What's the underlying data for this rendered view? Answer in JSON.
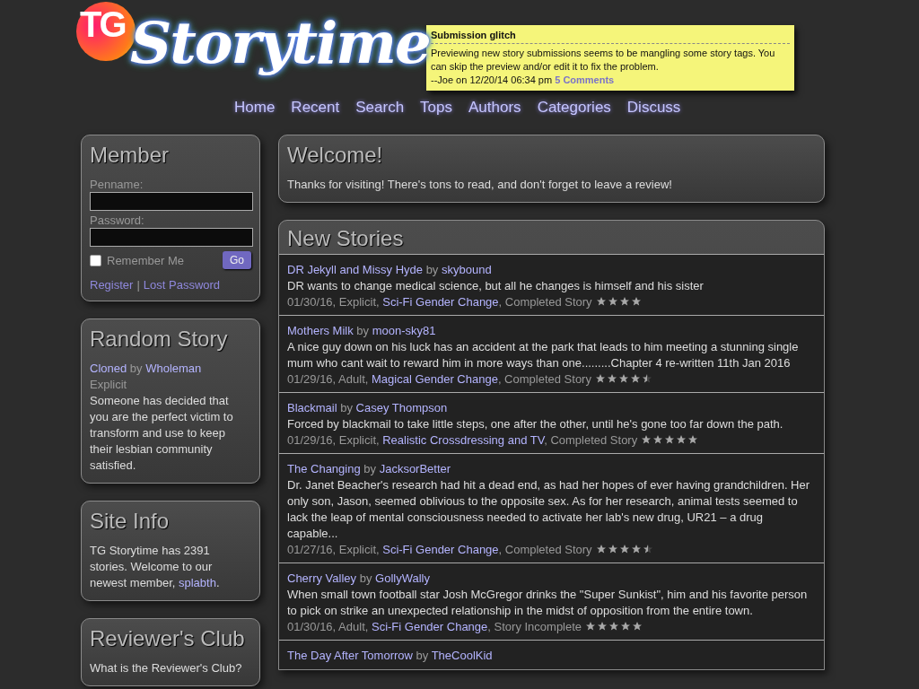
{
  "logo": {
    "badge": "TG",
    "wordmark": "Storytime"
  },
  "announcement": {
    "title": "Submission glitch",
    "body": "Previewing new story submissions seems to be mangling some story tags. You can skip the preview and/or edit it to fix the problem.",
    "byline": "--Joe on 12/20/14 06:34 pm",
    "link": "5 Comments"
  },
  "nav": [
    {
      "label": "Home"
    },
    {
      "label": "Recent"
    },
    {
      "label": "Search"
    },
    {
      "label": "Tops"
    },
    {
      "label": "Authors"
    },
    {
      "label": "Categories"
    },
    {
      "label": "Discuss"
    }
  ],
  "sidebar": {
    "member": {
      "title": "Member",
      "penname_label": "Penname:",
      "password_label": "Password:",
      "remember": {
        "label": "Remember Me",
        "checked": false
      },
      "button": "Go",
      "register": "Register",
      "separator": "|",
      "lost_password": "Lost Password"
    },
    "random_story": {
      "title": "Random Story",
      "story": "Cloned",
      "by": "by",
      "author": "Wholeman",
      "rating": "Explicit",
      "summary": "Someone has decided that you are the perfect victim to transform and use to keep their lesbian community satisfied."
    },
    "site_info": {
      "title": "Site Info",
      "text_before": "TG Storytime has 2391 stories. Welcome to our newest member, ",
      "member": "splabth",
      "text_after": "."
    },
    "reviewers_club": {
      "title": "Reviewer's Club",
      "text": "What is the Reviewer's Club?"
    }
  },
  "welcome": {
    "title": "Welcome!",
    "text": "Thanks for visiting! There's tons to read, and don't forget to leave a review!"
  },
  "new_stories": {
    "title": "New Stories",
    "stories": [
      {
        "title": "DR Jekyll and Missy Hyde",
        "by": "by",
        "author": "skybound",
        "summary": "DR wants to change medical science, but all he changes is himself and his sister",
        "meta_before": "01/30/16, Explicit, ",
        "category": "Sci-Fi Gender Change",
        "meta_after": ", Completed Story",
        "stars": 4
      },
      {
        "title": "Mothers Milk",
        "by": "by",
        "author": "moon-sky81",
        "summary": "A nice guy down on his luck has an accident at the park that leads to him meeting a stunning single mum who cant wait to reward him in more ways than one.........Chapter 4 re-written 11th Jan 2016",
        "meta_before": "01/29/16, Adult, ",
        "category": "Magical Gender Change",
        "meta_after": ", Completed Story",
        "stars": 4.5
      },
      {
        "title": "Blackmail",
        "by": "by",
        "author": "Casey Thompson",
        "summary": "Forced by blackmail to take little steps, one after the other, until he's gone too far down the path.",
        "meta_before": "01/29/16, Explicit, ",
        "category": "Realistic Crossdressing and TV",
        "meta_after": ", Completed Story",
        "stars": 5
      },
      {
        "title": "The Changing",
        "by": "by",
        "author": "JacksorBetter",
        "summary": "Dr. Janet Beacher's research had hit a dead end, as had her hopes of ever having grandchildren. Her only son, Jason, seemed oblivious to the opposite sex. As for her research, animal tests seemed to lack the leap of mental consciousness needed to activate her lab's new drug, UR21 – a drug capable...",
        "meta_before": "01/27/16, Explicit, ",
        "category": "Sci-Fi Gender Change",
        "meta_after": ", Completed Story",
        "stars": 4.5
      },
      {
        "title": "Cherry Valley",
        "by": "by",
        "author": "GollyWally",
        "summary": "When small town football star Josh McGregor drinks the \"Super Sunkist\", him and his favorite person to pick on strike an unexpected relationship in the midst of opposition from the entire town.",
        "meta_before": "01/30/16, Adult, ",
        "category": "Sci-Fi Gender Change",
        "meta_after": ", Story Incomplete",
        "stars": 5
      },
      {
        "title": "The Day After Tomorrow",
        "by": "by",
        "author": "TheCoolKid"
      }
    ]
  }
}
